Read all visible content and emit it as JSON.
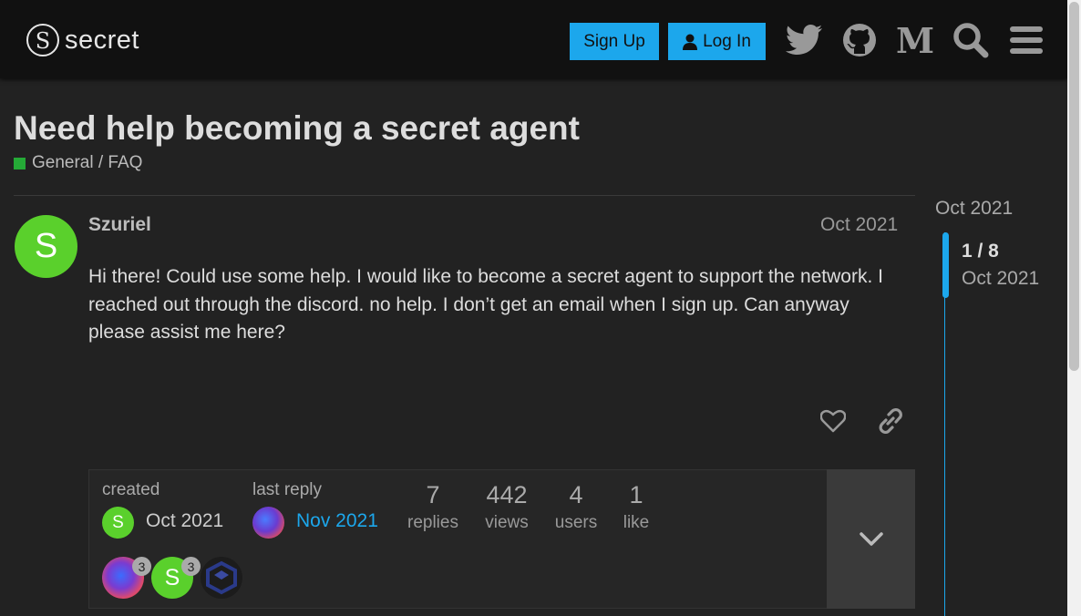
{
  "header": {
    "logo_letter": "S",
    "logo_text": "secret",
    "signup_label": "Sign Up",
    "login_label": "Log In",
    "icons": [
      "twitter-icon",
      "github-icon",
      "medium-icon",
      "search-icon",
      "hamburger-menu-icon"
    ],
    "accent_color": "#1ca7ec"
  },
  "topic": {
    "title": "Need help becoming a secret agent",
    "category": "General / FAQ",
    "category_color": "#25aa37"
  },
  "post": {
    "avatar_letter": "S",
    "avatar_color": "#5ad02c",
    "username": "Szuriel",
    "date": "Oct 2021",
    "body": "Hi there! Could use some help. I would like to become a secret agent to support the network. I reached out through the discord. no help. I don’t get an email when I sign up. Can anyway please assist me here?"
  },
  "topic_map": {
    "created_label": "created",
    "created_date": "Oct 2021",
    "created_avatar_letter": "S",
    "last_reply_label": "last reply",
    "last_reply_date": "Nov 2021",
    "stats": [
      {
        "num": "7",
        "label": "replies"
      },
      {
        "num": "442",
        "label": "views"
      },
      {
        "num": "4",
        "label": "users"
      },
      {
        "num": "1",
        "label": "like"
      }
    ],
    "participants": [
      {
        "badge": "3"
      },
      {
        "letter": "S",
        "badge": "3"
      },
      {}
    ]
  },
  "timeline": {
    "top_date": "Oct 2021",
    "position": "1 / 8",
    "current_date": "Oct 2021"
  }
}
